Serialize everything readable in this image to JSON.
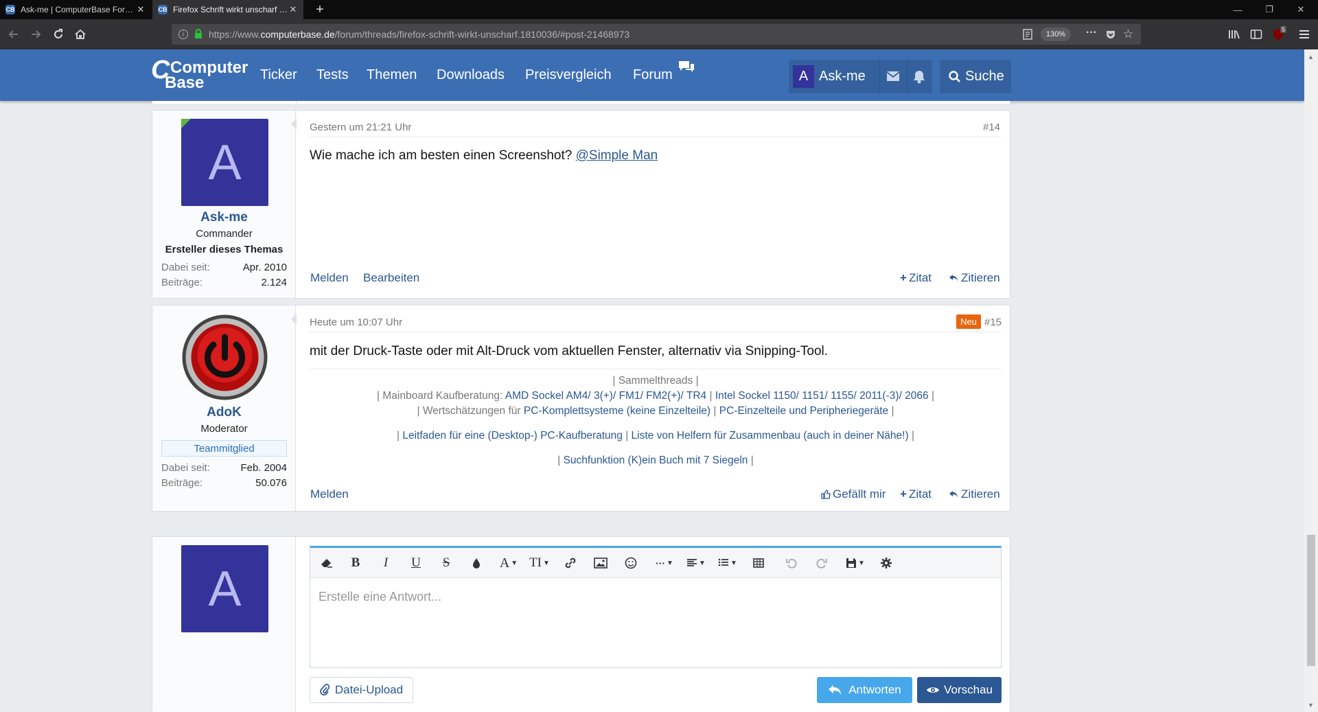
{
  "browser": {
    "tabs": [
      {
        "title": "Ask-me | ComputerBase Forum",
        "favicon": "CB"
      },
      {
        "title": "Firefox Schrift wirkt unscharf | ComputerBase Forum",
        "favicon": "CB"
      }
    ],
    "url_prefix": "https://www.",
    "url_domain": "computerbase.de",
    "url_path": "/forum/threads/firefox-schrift-wirkt-unscharf.1810036/#post-21468973",
    "zoom": "130%",
    "ublock_badge": "5"
  },
  "site": {
    "logo_top": "Computer",
    "logo_bottom": "Base",
    "nav": [
      "Ticker",
      "Tests",
      "Themen",
      "Downloads",
      "Preisvergleich",
      "Forum"
    ],
    "user_initial": "A",
    "user_name": "Ask-me",
    "search_label": "Suche"
  },
  "posts": [
    {
      "author": "Ask-me",
      "avatar_letter": "A",
      "user_title": "Commander",
      "badge": "Ersteller dieses Themas",
      "stats": [
        {
          "label": "Dabei seit:",
          "value": "Apr. 2010"
        },
        {
          "label": "Beiträge:",
          "value": "2.124"
        }
      ],
      "time": "Gestern um 21:21 Uhr",
      "number": "#14",
      "text": "Wie mache ich am besten einen Screenshot?",
      "mention": "@Simple Man",
      "actions_left": [
        "Melden",
        "Bearbeiten"
      ],
      "actions_right": [
        "Zitat",
        "Zitieren"
      ]
    },
    {
      "author": "AdoK",
      "user_title": "Moderator",
      "badge": "Teammitglied",
      "stats": [
        {
          "label": "Dabei seit:",
          "value": "Feb. 2004"
        },
        {
          "label": "Beiträge:",
          "value": "50.076"
        }
      ],
      "time": "Heute um 10:07 Uhr",
      "new_label": "Neu",
      "number": "#15",
      "text": "mit der Druck-Taste oder mit Alt-Druck vom aktuellen Fenster, alternativ via Snipping-Tool.",
      "signature": {
        "line1": "| Sammelthreads |",
        "line2_prefix": "| Mainboard Kaufberatung:",
        "link_amd": "AMD Sockel AM4/ 3(+)/ FM1/ FM2(+)/ TR4",
        "link_intel": "Intel Sockel 1150/ 1151/ 1155/ 2011(-3)/ 2066",
        "line3_prefix": "| Wertschätzungen für",
        "link_pc": "PC-Komplettsysteme (keine Einzelteile)",
        "link_parts": "PC-Einzelteile und Peripheriegeräte",
        "link_guide": "Leitfaden für eine (Desktop-) PC-Kaufberatung",
        "link_helpers": "Liste von Helfern für Zusammenbau (auch in deiner Nähe!)",
        "link_search": "Suchfunktion (K)ein Buch mit 7 Siegeln",
        "sep": "|"
      },
      "actions_left": [
        "Melden"
      ],
      "actions_right": [
        "Gefällt mir",
        "Zitat",
        "Zitieren"
      ]
    }
  ],
  "reply": {
    "avatar_letter": "A",
    "placeholder": "Erstelle eine Antwort...",
    "upload_label": "Datei-Upload",
    "submit_label": "Antworten",
    "preview_label": "Vorschau"
  },
  "colors": {
    "brand": "#3c6eb4",
    "link": "#2b5792",
    "new_badge": "#e8650f"
  }
}
